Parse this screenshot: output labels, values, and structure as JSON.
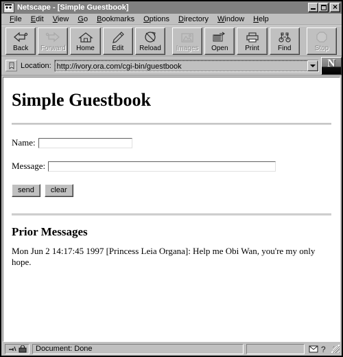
{
  "window": {
    "title": "Netscape - [Simple Guestbook]",
    "icon": "netscape-app-icon",
    "controls": {
      "minimize": "minimize",
      "maximize": "maximize",
      "close": "close"
    }
  },
  "menubar": {
    "items": [
      {
        "label": "File",
        "accel": "F"
      },
      {
        "label": "Edit",
        "accel": "E"
      },
      {
        "label": "View",
        "accel": "V"
      },
      {
        "label": "Go",
        "accel": "G"
      },
      {
        "label": "Bookmarks",
        "accel": "B"
      },
      {
        "label": "Options",
        "accel": "O"
      },
      {
        "label": "Directory",
        "accel": "D"
      },
      {
        "label": "Window",
        "accel": "W"
      },
      {
        "label": "Help",
        "accel": "H"
      }
    ]
  },
  "toolbar": {
    "buttons": [
      {
        "label": "Back",
        "icon": "back-arrow-icon",
        "enabled": true
      },
      {
        "label": "Forward",
        "icon": "forward-arrow-icon",
        "enabled": false
      },
      {
        "label": "Home",
        "icon": "house-icon",
        "enabled": true
      },
      {
        "label": "Edit",
        "icon": "pencil-icon",
        "enabled": true
      },
      {
        "label": "Reload",
        "icon": "reload-icon",
        "enabled": true
      },
      {
        "label": "Images",
        "icon": "images-icon",
        "enabled": false
      },
      {
        "label": "Open",
        "icon": "open-icon",
        "enabled": true
      },
      {
        "label": "Print",
        "icon": "printer-icon",
        "enabled": true
      },
      {
        "label": "Find",
        "icon": "binoculars-icon",
        "enabled": true
      },
      {
        "label": "Stop",
        "icon": "stop-sign-icon",
        "enabled": false
      }
    ]
  },
  "location": {
    "icon": "bookmark-quickfile-icon",
    "label": "Location:",
    "url": "http://ivory.ora.com/cgi-bin/guestbook",
    "dropdown_icon": "chevron-down-icon",
    "logo_letter": "N"
  },
  "page": {
    "heading": "Simple Guestbook",
    "form": {
      "name_label": "Name:",
      "name_value": "",
      "message_label": "Message:",
      "message_value": "",
      "send_label": "send",
      "clear_label": "clear"
    },
    "prior_heading": "Prior Messages",
    "messages": [
      "Mon Jun 2 14:17:45 1997 [Princess Leia Organa]: Help me Obi Wan, you're my only hope."
    ]
  },
  "statusbar": {
    "security_icons": [
      "broken-key-icon",
      "padlock-icon"
    ],
    "text": "Document: Done",
    "right_icons": [
      "mail-envelope-icon",
      "question-mark-icon"
    ],
    "resize_grip": "resize-grip-icon"
  },
  "colors": {
    "chrome": "#c0c0c0",
    "titlebar": "#808080",
    "titlebar_text": "#ffffff",
    "page_bg": "#ffffff",
    "text": "#000000",
    "disabled_text": "#8a8a8a"
  }
}
